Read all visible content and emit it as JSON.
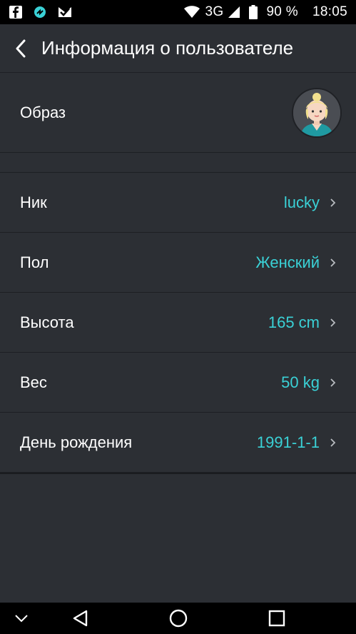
{
  "status_bar": {
    "network": "3G",
    "battery": "90 %",
    "time": "18:05",
    "icons": [
      "facebook-icon",
      "app-icon",
      "email-check-icon",
      "wifi-icon",
      "signal-icon",
      "battery-icon"
    ]
  },
  "header": {
    "title": "Информация о пользователе"
  },
  "avatar_row": {
    "label": "Образ"
  },
  "fields": [
    {
      "label": "Ник",
      "value": "lucky"
    },
    {
      "label": "Пол",
      "value": "Женский"
    },
    {
      "label": "Высота",
      "value": "165 cm"
    },
    {
      "label": "Вес",
      "value": "50 kg"
    },
    {
      "label": "День рождения",
      "value": "1991-1-1"
    }
  ],
  "colors": {
    "background": "#2c2f34",
    "accent": "#3ad1d6",
    "divider": "#1d1f23"
  },
  "nav_bar": {
    "icons": [
      "chevron-down-icon",
      "back-triangle-icon",
      "home-circle-icon",
      "recents-square-icon"
    ]
  }
}
